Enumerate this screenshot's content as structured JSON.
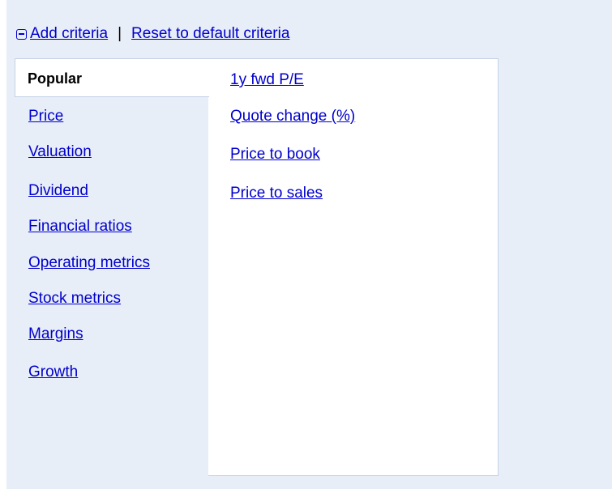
{
  "toolbar": {
    "add_label": "Add criteria",
    "separator": "|",
    "reset_label": "Reset to default criteria"
  },
  "categories": {
    "active": "Popular",
    "items": [
      "Price",
      "Valuation",
      "Dividend",
      "Financial ratios",
      "Operating metrics",
      "Stock metrics",
      "Margins",
      "Growth"
    ]
  },
  "options": [
    "1y fwd P/E",
    "Quote change (%)",
    "Price to book",
    "Price to sales"
  ]
}
